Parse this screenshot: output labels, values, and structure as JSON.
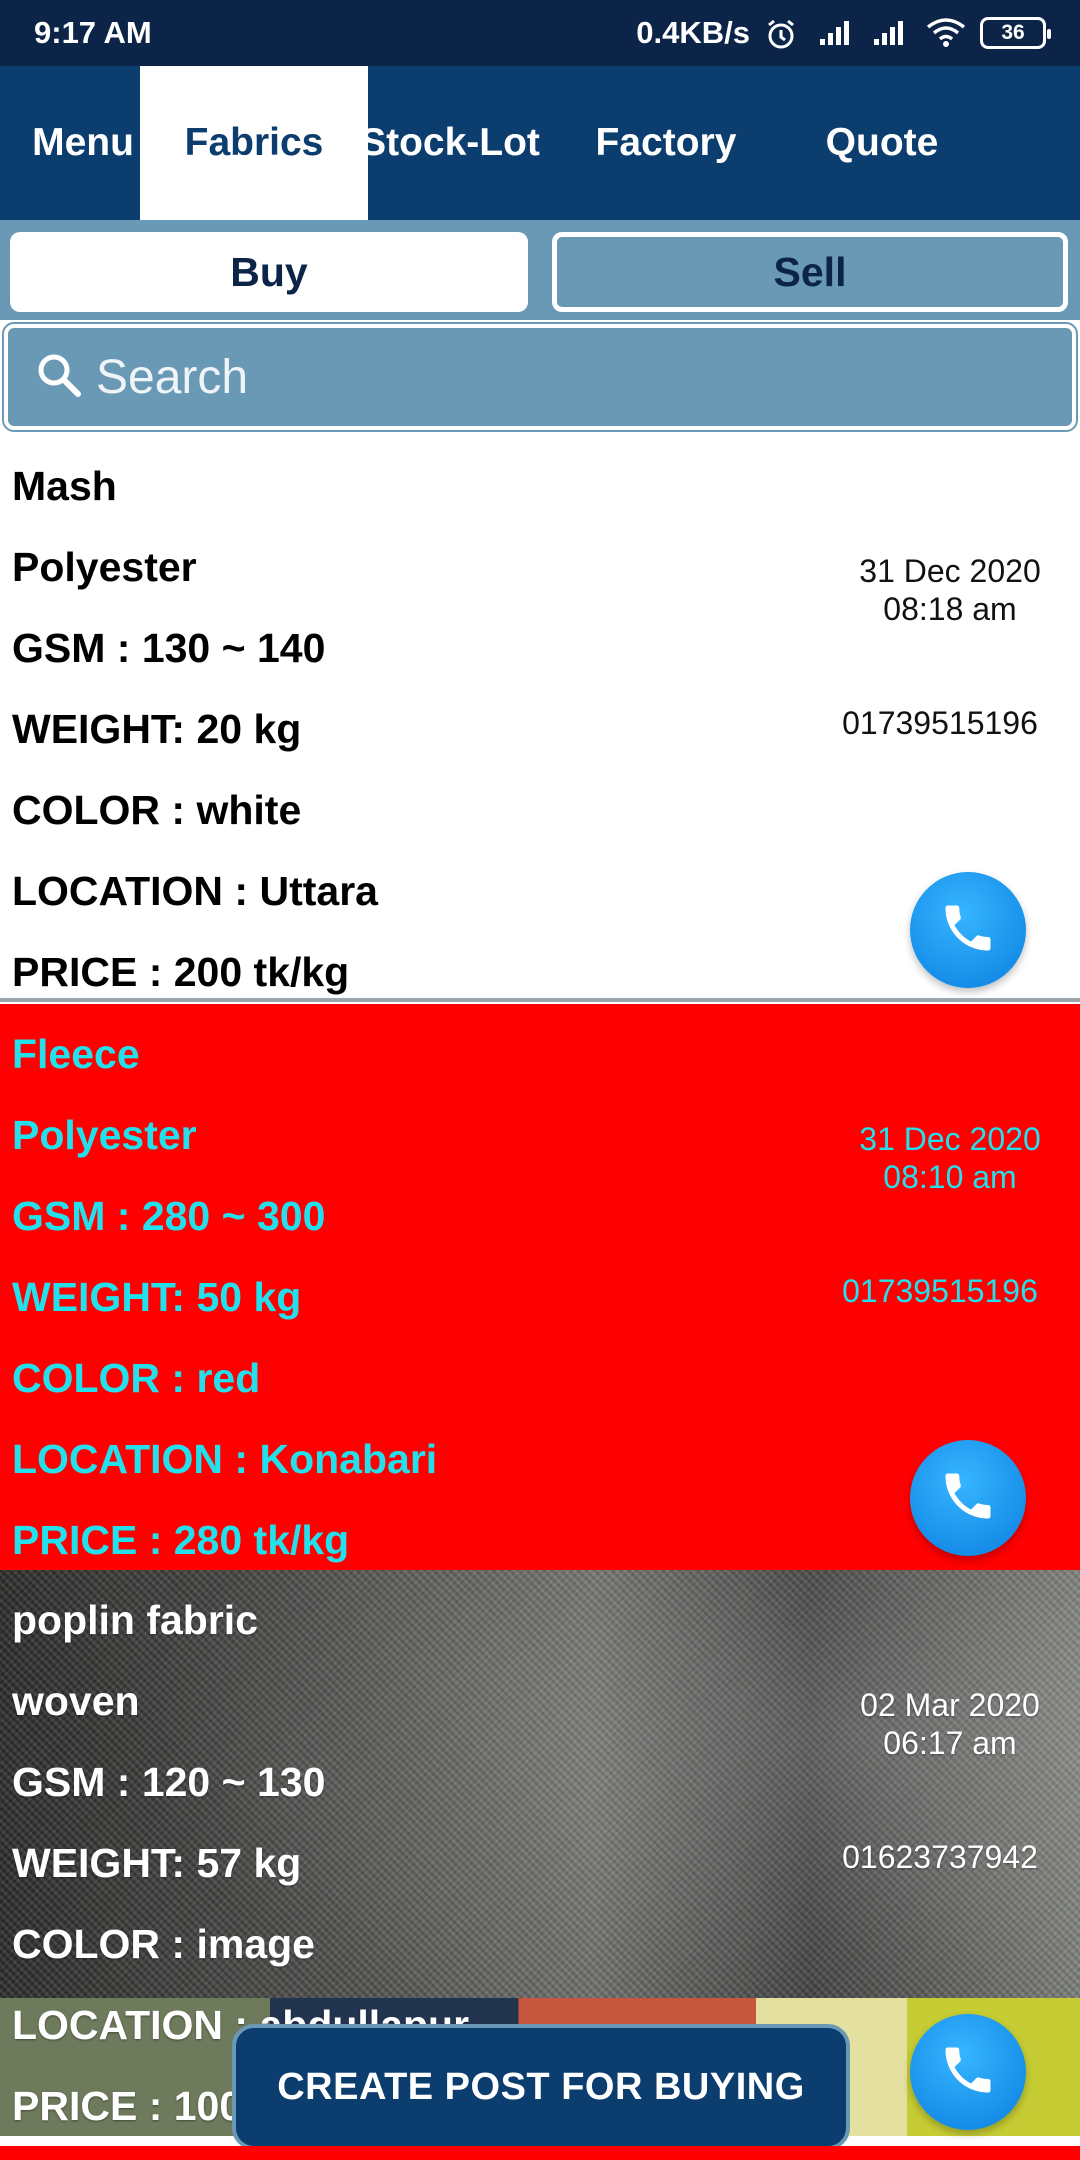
{
  "status_bar": {
    "time": "9:17 AM",
    "net_speed": "0.4KB/s",
    "battery": "36"
  },
  "tabs": [
    {
      "label": "Menu",
      "active": false
    },
    {
      "label": "Fabrics",
      "active": true
    },
    {
      "label": "Stock-Lot",
      "active": false
    },
    {
      "label": "Factory",
      "active": false
    },
    {
      "label": "Quote",
      "active": false
    }
  ],
  "segment": {
    "buy": "Buy",
    "sell": "Sell",
    "selected": "Buy"
  },
  "search": {
    "placeholder": "Search",
    "value": ""
  },
  "listings": [
    {
      "name": "Mash",
      "type": "Polyester",
      "gsm": "GSM : 130 ~ 140",
      "weight": "WEIGHT: 20 kg",
      "color": "COLOR : white",
      "location": "LOCATION : Uttara",
      "price": "PRICE : 200 tk/kg",
      "date": "31 Dec 2020",
      "time": "08:18 am",
      "phone": "01739515196"
    },
    {
      "name": "Fleece",
      "type": "Polyester",
      "gsm": "GSM : 280 ~ 300",
      "weight": "WEIGHT: 50 kg",
      "color": "COLOR : red",
      "location": "LOCATION : Konabari",
      "price": "PRICE : 280 tk/kg",
      "date": "31 Dec 2020",
      "time": "08:10 am",
      "phone": "01739515196"
    },
    {
      "name": "poplin fabric",
      "type": "woven",
      "gsm": "GSM : 120 ~ 130",
      "weight": "WEIGHT: 57 kg",
      "color": "COLOR : image",
      "location": "LOCATION : abdullapur",
      "price": "PRICE : 100",
      "date": "02 Mar 2020",
      "time": "06:17 am",
      "phone": "01623737942"
    }
  ],
  "create_post_label": "CREATE POST FOR BUYING",
  "colors": {
    "primary": "#0b3d6e",
    "status_bar": "#0b2447",
    "segment_bg": "#6a99b5",
    "card_red": "#ff0000",
    "card_red_text": "#22e0ec",
    "call_button": "#1e9bf0"
  }
}
